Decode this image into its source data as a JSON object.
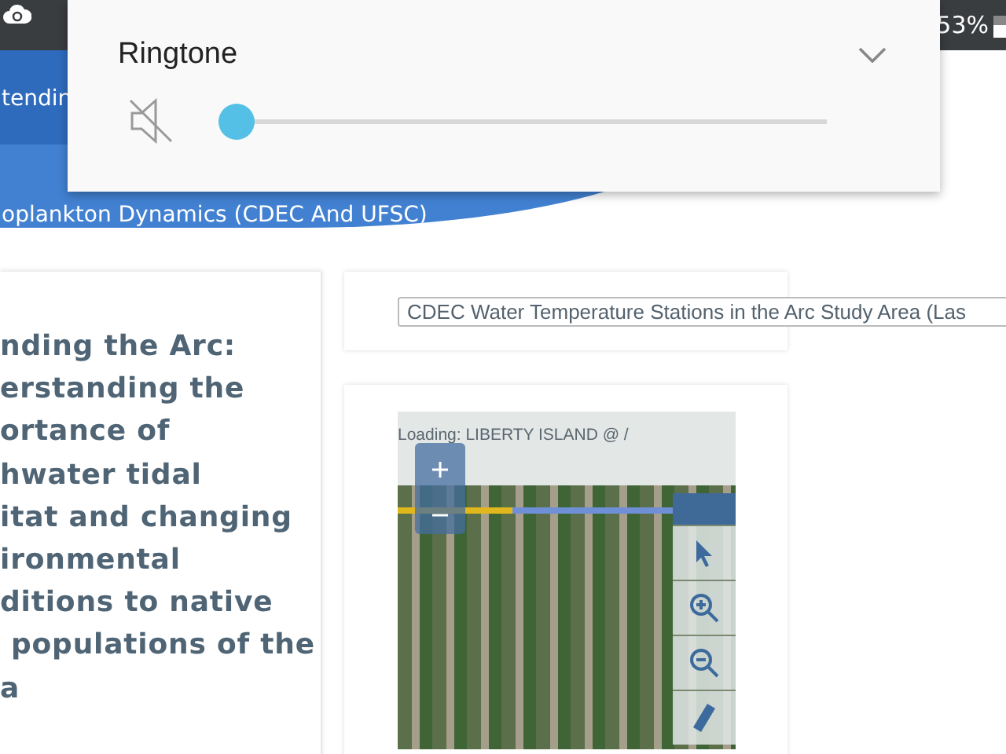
{
  "status_bar": {
    "battery_text": "53%"
  },
  "nav": {
    "items": [
      {
        "label": "tendin",
        "selected": true
      },
      {
        "label": "oplankton Dynamics (CDEC And UFSC)",
        "selected": false
      }
    ]
  },
  "volume_popup": {
    "title": "Ringtone",
    "muted": true,
    "level": 0,
    "expanded": false
  },
  "story_title": {
    "lines": [
      "nding the Arc:",
      "erstanding the",
      "ortance of",
      "hwater tidal",
      "itat and changing",
      "ironmental",
      "ditions to native",
      "populations of the",
      "a"
    ]
  },
  "layer_select": {
    "value": "CDEC Water Temperature Stations in the Arc Study Area (Las"
  },
  "map": {
    "loading_text": "Loading: LIBERTY ISLAND @ /",
    "loading": {
      "level": 0.34
    }
  }
}
